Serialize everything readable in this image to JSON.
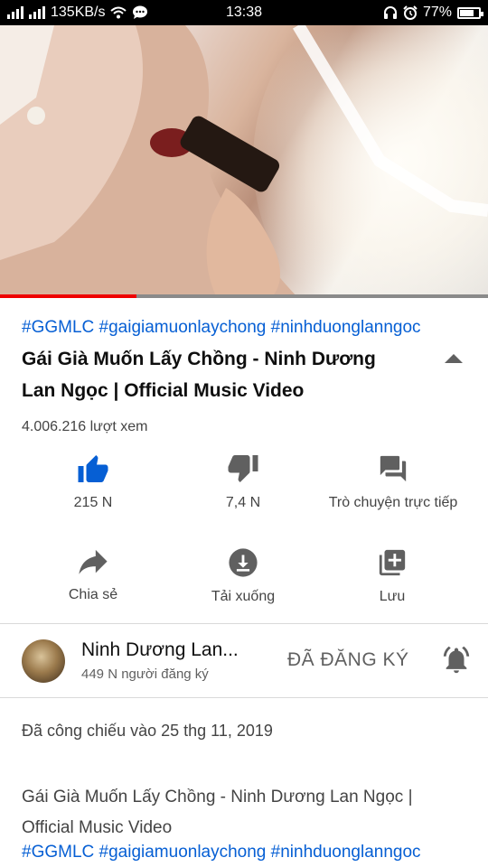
{
  "status_bar": {
    "net_speed": "135KB/s",
    "time": "13:38",
    "battery": "77%",
    "battery_level": 0.77
  },
  "video": {
    "progress": 0.28
  },
  "info": {
    "hashtags": "#GGMLC #gaigiamuonlaychong #ninhduonglanngoc",
    "title": "Gái Già Muốn Lấy Chồng - Ninh Dương Lan Ngọc | Official Music Video",
    "views": "4.006.216 lượt xem"
  },
  "actions": {
    "like": "215 N",
    "dislike": "7,4 N",
    "live_chat": "Trò chuyện trực tiếp",
    "share": "Chia sẻ",
    "download": "Tải xuống",
    "save": "Lưu"
  },
  "channel": {
    "name": "Ninh Dương Lan...",
    "subscribers": "449 N người đăng ký",
    "subscribed_label": "ĐÃ ĐĂNG KÝ"
  },
  "description": {
    "premiere": "Đã công chiếu vào 25 thg 11, 2019",
    "text": "Gái Già Muốn Lấy Chồng - Ninh Dương Lan Ngọc | Official Music Video",
    "hashtags": "#GGMLC  #gaigiamuonlaychong #ninhduonglanngoc"
  },
  "colors": {
    "accent_blue": "#065fd4",
    "progress_red": "#ee0000",
    "icon_gray": "#606060"
  }
}
